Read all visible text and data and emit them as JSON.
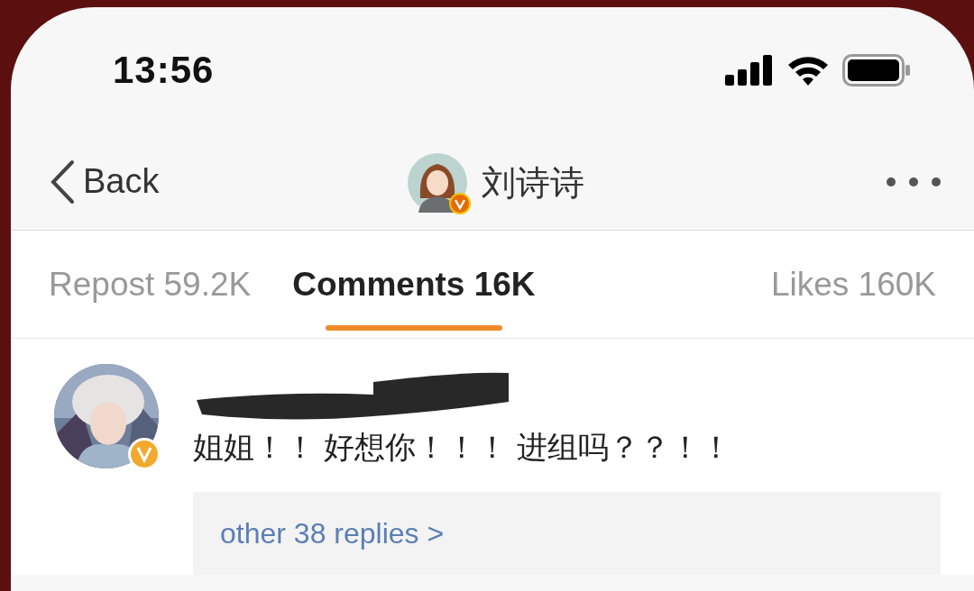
{
  "status_bar": {
    "time": "13:56"
  },
  "nav": {
    "back_label": "Back",
    "title": "刘诗诗"
  },
  "tabs": [
    {
      "label": "Repost 59.2K",
      "selected": false
    },
    {
      "label": "Comments 16K",
      "selected": true
    },
    {
      "label": "Likes 160K",
      "selected": false
    }
  ],
  "comments": [
    {
      "text": "姐姐！！ 好想你！！！ 进组吗？？！！",
      "replies": "other 38 replies >"
    }
  ]
}
